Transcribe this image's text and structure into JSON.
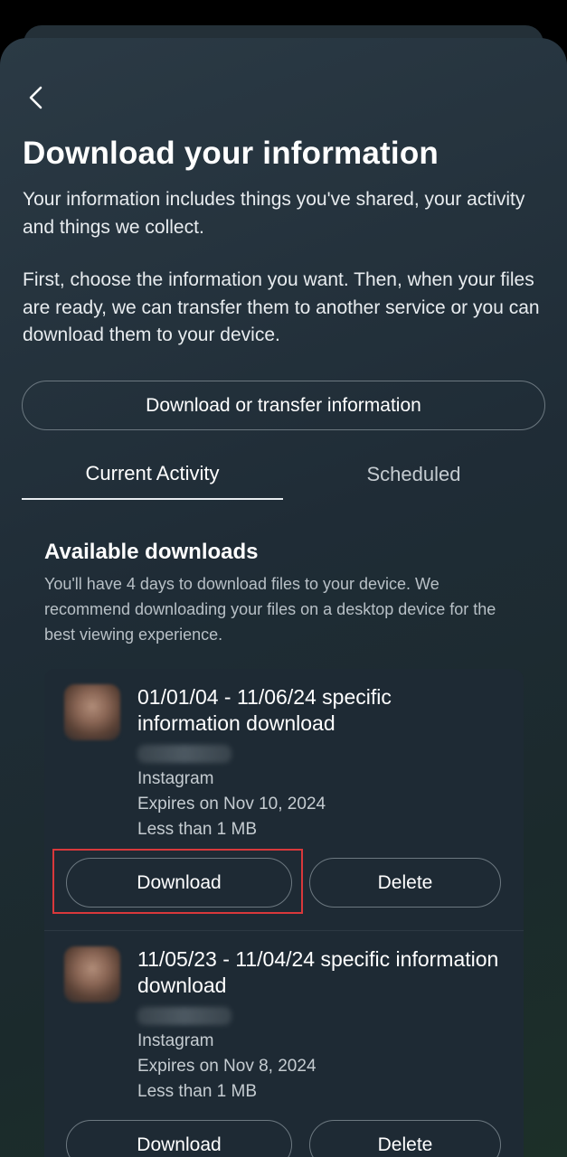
{
  "header": {
    "title": "Download your information"
  },
  "intro": {
    "paragraph1": "Your information includes things you've shared, your activity and things we collect.",
    "paragraph2": "First, choose the information you want. Then, when your files are ready, we can transfer them to another service or you can download them to your device."
  },
  "primary_button": "Download or transfer information",
  "tabs": [
    {
      "label": "Current Activity",
      "active": true
    },
    {
      "label": "Scheduled",
      "active": false
    }
  ],
  "section": {
    "title": "Available downloads",
    "description": "You'll have 4 days to download files to your device. We recommend downloading your files on a desktop device for the best viewing experience."
  },
  "downloads": [
    {
      "title": "01/01/04 - 11/06/24 specific information download",
      "platform": "Instagram",
      "expires": "Expires on Nov 10, 2024",
      "size": "Less than 1 MB",
      "download_label": "Download",
      "delete_label": "Delete"
    },
    {
      "title": "11/05/23 - 11/04/24 specific information download",
      "platform": "Instagram",
      "expires": "Expires on Nov 8, 2024",
      "size": "Less than 1 MB",
      "download_label": "Download",
      "delete_label": "Delete"
    }
  ],
  "colors": {
    "highlight": "#d9383b",
    "background": "#1f2c36",
    "panel": "#1e2a34"
  }
}
